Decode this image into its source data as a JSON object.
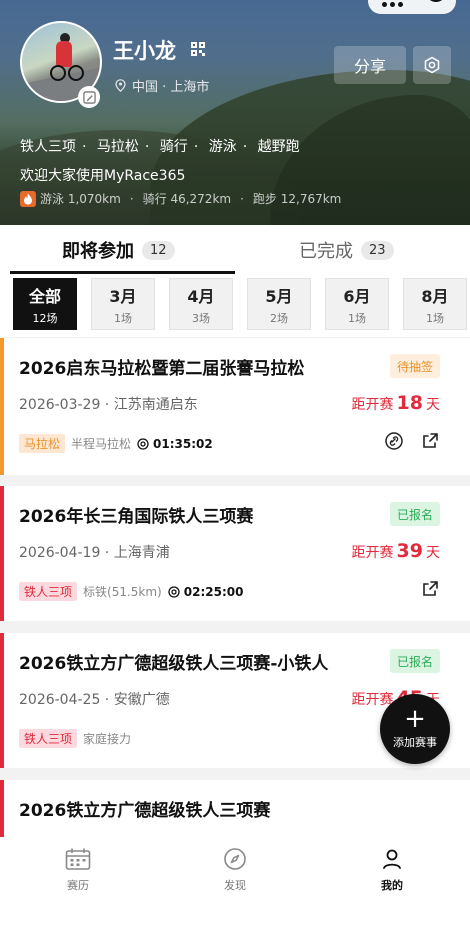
{
  "profile": {
    "name": "王小龙",
    "location": "中国 · 上海市",
    "tags": [
      "铁人三项",
      "马拉松",
      "骑行",
      "游泳",
      "越野跑"
    ],
    "welcome": "欢迎大家使用MyRace365",
    "stats": [
      "游泳 1,070km",
      "骑行 46,272km",
      "跑步 12,767km"
    ],
    "share_label": "分享"
  },
  "tabs": [
    {
      "label": "即将参加",
      "count": "12"
    },
    {
      "label": "已完成",
      "count": "23"
    }
  ],
  "months": [
    {
      "label": "全部",
      "count": "12场"
    },
    {
      "label": "3月",
      "count": "1场"
    },
    {
      "label": "4月",
      "count": "3场"
    },
    {
      "label": "5月",
      "count": "2场"
    },
    {
      "label": "6月",
      "count": "1场"
    },
    {
      "label": "8月",
      "count": "1场"
    }
  ],
  "events": [
    {
      "title": "2026启东马拉松暨第二届张謇马拉松",
      "status": "待抽签",
      "meta": "2026-03-29 · 江苏南通启东",
      "countdown_prefix": "距开赛",
      "countdown_days": "18",
      "countdown_suffix": "天",
      "tag": "马拉松",
      "distance": "半程马拉松",
      "time": "01:35:02",
      "accent": "#f29a2e"
    },
    {
      "title": "2026年长三角国际铁人三项赛",
      "status": "已报名",
      "meta": "2026-04-19 · 上海青浦",
      "countdown_prefix": "距开赛",
      "countdown_days": "39",
      "countdown_suffix": "天",
      "tag": "铁人三项",
      "distance": "标铁(51.5km)",
      "time": "02:25:00",
      "accent": "#e12a3c"
    },
    {
      "title": "2026铁立方广德超级铁人三项赛-小铁人",
      "status": "已报名",
      "meta": "2026-04-25 · 安徽广德",
      "countdown_prefix": "距开赛",
      "countdown_days": "45",
      "countdown_suffix": "天",
      "tag": "铁人三项",
      "distance": "家庭接力",
      "accent": "#e12a3c"
    },
    {
      "title": "2026铁立方广德超级铁人三项赛",
      "accent": "#e12a3c"
    }
  ],
  "fab_label": "添加赛事",
  "nav": [
    {
      "label": "赛历"
    },
    {
      "label": "发现"
    },
    {
      "label": "我的"
    }
  ]
}
